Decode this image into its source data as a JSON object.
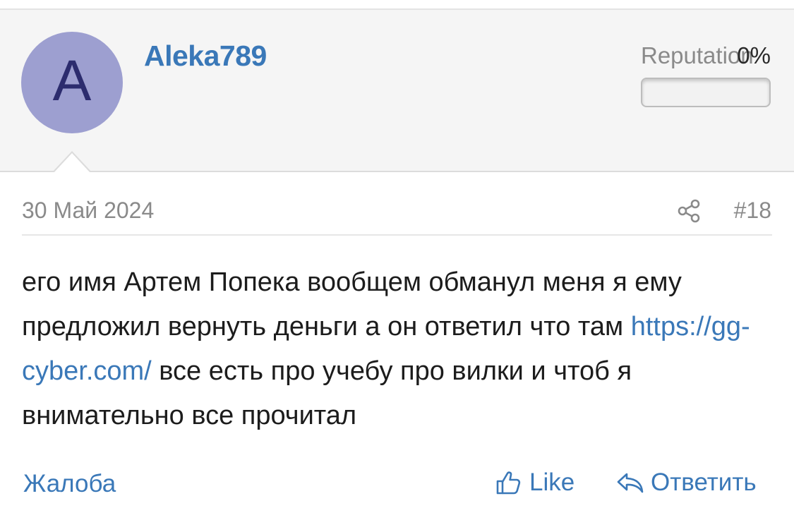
{
  "user": {
    "avatar_letter": "A",
    "avatar_color": "#9d9fd0",
    "name": "Aleka789"
  },
  "reputation": {
    "label": "Reputation",
    "value_text": "0%",
    "level": 0
  },
  "post": {
    "date": "30 Май 2024",
    "number": "#18",
    "share_icon": "share-icon",
    "text_before": "его имя Артем Попека вообщем обманул меня я ему предложил вернуть деньги а он ответил что там ",
    "link": "https://gg-cyber.com/",
    "text_after": " все есть про учебу про вилки и чтоб я внимательно все прочитал"
  },
  "actions": {
    "report_label": "Жалоба",
    "like_label": "Like",
    "like_icon": "thumbs-up-icon",
    "reply_label": "Ответить",
    "reply_icon": "reply-arrow-icon"
  },
  "colors": {
    "accent": "#3a78b8",
    "muted_text": "#8a8a8a",
    "header_bg": "#f5f5f5"
  }
}
